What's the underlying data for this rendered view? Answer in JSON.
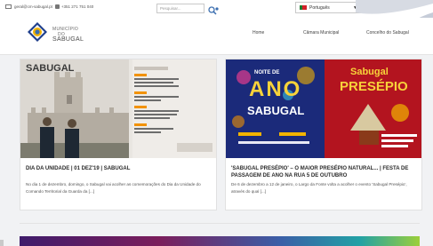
{
  "topbar": {
    "email": "geral@cm-sabugal.pt",
    "phone": "+351 271 751 040",
    "search_placeholder": "Pesquisar...",
    "language": "Português"
  },
  "header": {
    "logo_line1": "MUNICÍPIO",
    "logo_line2": "DO",
    "logo_line3": "SABUGAL",
    "nav": [
      "Home",
      "Câmara Municipal",
      "Concelho do Sabugal"
    ]
  },
  "posts": [
    {
      "image_word": "SABUGAL",
      "title": "DIA DA UNIDADE | 01 DEZ'19 | SABUGAL",
      "excerpt": "No dia 1 de dezembro, domingo, o Sabugal vai acolher as comemorações do Dia da Unidade do Comando Territorial da Guarda da [...]"
    },
    {
      "poster_left_line1": "NOITE DE",
      "poster_left_line2": "ANO",
      "poster_left_line3": "SABUGAL",
      "poster_right_line1": "Sabugal",
      "poster_right_line2": "PRESÉPIO",
      "title": "'SABUGAL PRESÉPIO' – O MAIOR PRESÉPIO NATURAL... | FESTA DE PASSAGEM DE ANO NA RUA 5 DE OUTUBRO",
      "excerpt": "De 6 de dezembro a 12 de janeiro, o Largo da Fonte volta a acolher o evento 'Sabugal Presépio', através do qual [...]"
    }
  ],
  "colors": {
    "poster_left_bg": "#1b2a7a",
    "poster_right_bg": "#b3141f",
    "sabugal_orange": "#f29200"
  }
}
